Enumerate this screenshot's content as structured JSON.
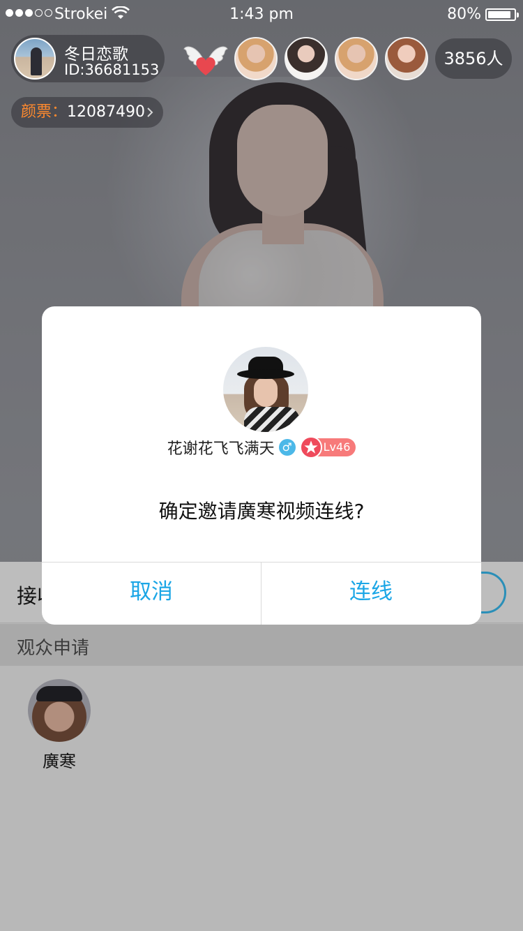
{
  "status_bar": {
    "carrier": "Strokei",
    "time": "1:43 pm",
    "battery": "80%",
    "battery_level": 0.8,
    "signal_bars_filled": 3,
    "signal_bars_total": 5
  },
  "host": {
    "name": "冬日恋歌",
    "id_text": "ID:36681153"
  },
  "viewers": {
    "count_text": "3856人",
    "avatars": [
      "viewer-avatar",
      "viewer-avatar",
      "viewer-avatar",
      "viewer-avatar"
    ]
  },
  "coins": {
    "label": "颜票：",
    "value": "12087490"
  },
  "sheet": {
    "row1_label": "接收",
    "section_label": "观众申请",
    "applicants": [
      {
        "name": "廣寒"
      }
    ]
  },
  "modal": {
    "username": "花谢花飞飞满天",
    "gender_symbol": "♂",
    "level": "Lv46",
    "question": "确定邀请廣寒视频连线?",
    "cancel_label": "取消",
    "confirm_label": "连线"
  },
  "colors": {
    "accent": "#1ba6e6",
    "coin_label": "#ff8a2e",
    "level_badge": "#f77a7a",
    "gender_badge": "#4cb8e8"
  },
  "icons": {
    "wifi": "wifi-icon",
    "battery": "battery-icon",
    "wings_heart": "wings-heart-icon",
    "chevron": "chevron-right-icon",
    "gender": "male-icon",
    "level_star": "star-icon"
  }
}
